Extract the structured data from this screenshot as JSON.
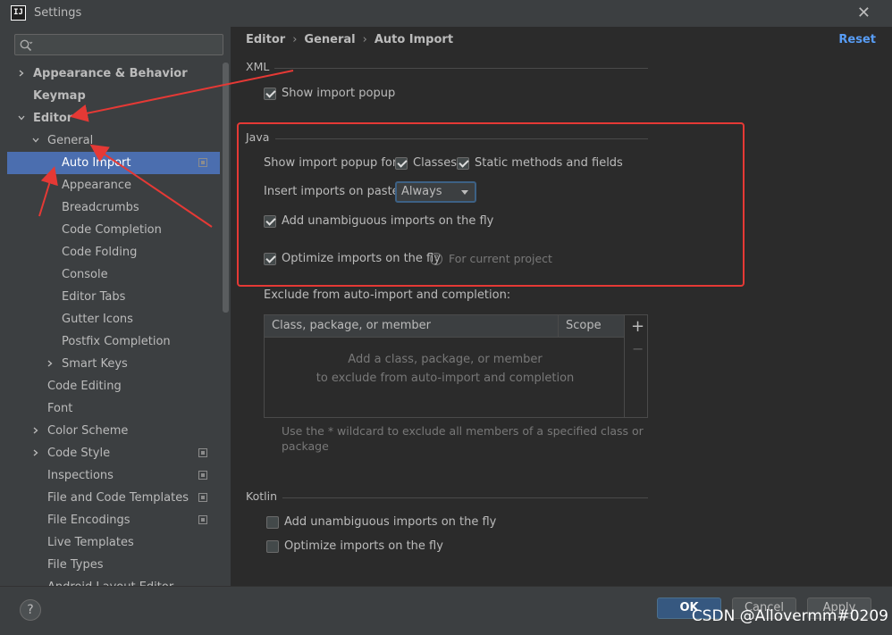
{
  "window": {
    "title": "Settings",
    "app_icon": "IJ"
  },
  "search": {
    "placeholder": ""
  },
  "sidebar": {
    "items": [
      {
        "label": "Appearance & Behavior",
        "level": 0,
        "bold": true,
        "chevron": "right"
      },
      {
        "label": "Keymap",
        "level": 0,
        "bold": true,
        "chevron": ""
      },
      {
        "label": "Editor",
        "level": 0,
        "bold": true,
        "chevron": "down"
      },
      {
        "label": "General",
        "level": 1,
        "chevron": "down"
      },
      {
        "label": "Auto Import",
        "level": 2,
        "selected": true,
        "copy": true
      },
      {
        "label": "Appearance",
        "level": 2
      },
      {
        "label": "Breadcrumbs",
        "level": 2
      },
      {
        "label": "Code Completion",
        "level": 2
      },
      {
        "label": "Code Folding",
        "level": 2
      },
      {
        "label": "Console",
        "level": 2
      },
      {
        "label": "Editor Tabs",
        "level": 2
      },
      {
        "label": "Gutter Icons",
        "level": 2
      },
      {
        "label": "Postfix Completion",
        "level": 2
      },
      {
        "label": "Smart Keys",
        "level": 2,
        "chevron": "right"
      },
      {
        "label": "Code Editing",
        "level": 1
      },
      {
        "label": "Font",
        "level": 1
      },
      {
        "label": "Color Scheme",
        "level": 1,
        "chevron": "right"
      },
      {
        "label": "Code Style",
        "level": 1,
        "chevron": "right",
        "copy": true
      },
      {
        "label": "Inspections",
        "level": 1,
        "copy": true
      },
      {
        "label": "File and Code Templates",
        "level": 1,
        "copy": true
      },
      {
        "label": "File Encodings",
        "level": 1,
        "copy": true
      },
      {
        "label": "Live Templates",
        "level": 1
      },
      {
        "label": "File Types",
        "level": 1
      },
      {
        "label": "Android Layout Editor",
        "level": 1
      }
    ]
  },
  "breadcrumb": {
    "part1": "Editor",
    "part2": "General",
    "part3": "Auto Import",
    "separator": "›"
  },
  "reset_label": "Reset",
  "xml": {
    "title": "XML",
    "show_import_popup": {
      "label": "Show import popup",
      "checked": true
    }
  },
  "java": {
    "title": "Java",
    "show_popup_for_label": "Show import popup for:",
    "classes": {
      "label": "Classes",
      "checked": true
    },
    "static_methods": {
      "label": "Static methods and fields",
      "checked": true
    },
    "insert_on_paste_label": "Insert imports on paste:",
    "insert_on_paste_value": "Always",
    "add_unambiguous": {
      "label": "Add unambiguous imports on the fly",
      "checked": true
    },
    "optimize": {
      "label": "Optimize imports on the fly",
      "checked": true
    },
    "optimize_hint": "For current project"
  },
  "exclude": {
    "label": "Exclude from auto-import and completion:",
    "col_class": "Class, package, or member",
    "col_scope": "Scope",
    "empty_line1": "Add a class, package, or member",
    "empty_line2": "to exclude from auto-import and completion",
    "wildcard_line1": "Use the * wildcard to exclude all members of a specified class or",
    "wildcard_line2": "package"
  },
  "kotlin": {
    "title": "Kotlin",
    "add_unambiguous": {
      "label": "Add unambiguous imports on the fly",
      "checked": false
    },
    "optimize": {
      "label": "Optimize imports on the fly",
      "checked": false
    }
  },
  "footer": {
    "help": "?",
    "ok": "OK",
    "cancel": "Cancel",
    "apply": "Apply"
  },
  "watermark": "CSDN @Allovermm#0209",
  "colors": {
    "selection": "#4b6eaf",
    "annotation": "#e53935",
    "link": "#589df6"
  }
}
